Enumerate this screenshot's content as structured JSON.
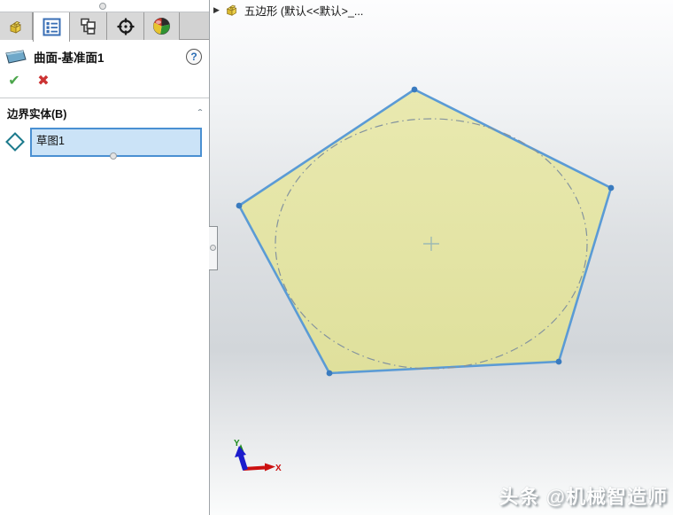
{
  "panel": {
    "tabs": [
      {
        "id": "featuremanager",
        "icon": "part-icon",
        "active": false
      },
      {
        "id": "propertymanager",
        "icon": "property-list-icon",
        "active": true
      },
      {
        "id": "configurationmanager",
        "icon": "configurations-icon",
        "active": false
      },
      {
        "id": "dimxpertmanager",
        "icon": "target-icon",
        "active": false
      },
      {
        "id": "displaymanager",
        "icon": "color-sphere-icon",
        "active": false
      }
    ],
    "header": {
      "title": "曲面-基准面1",
      "help_label": "?",
      "icon": "plane-icon"
    },
    "actions": {
      "ok_label": "✔",
      "cancel_label": "✖"
    },
    "section": {
      "label": "边界实体(B)",
      "collapse_label": "ˆ"
    },
    "selection_list": {
      "icon": "contour-diamond-icon",
      "items": [
        {
          "label": "草图1"
        }
      ]
    }
  },
  "viewport": {
    "tree": {
      "expand_label": "▶",
      "icon": "part-icon",
      "label": "五边形  (默认<<默认>_..."
    },
    "triad": {
      "x_label": "X",
      "y_label": "Y"
    },
    "watermark": "头条 @机械智造师"
  },
  "colors": {
    "accent-blue": "#4a90d2",
    "selection-fill": "#cbe3f7",
    "pentagon-fill": "#e7e7ab",
    "pentagon-fill-dark": "#dfe09c",
    "edge-blue": "#5b9bd5",
    "vertex-blue": "#3a7bbf",
    "construction-gray": "#84939e",
    "ok-green": "#4ca64c",
    "cancel-red": "#cc3333",
    "axis-red": "#cc1111",
    "axis-green": "#1d8a1d",
    "axis-blue": "#1c1ccc"
  }
}
